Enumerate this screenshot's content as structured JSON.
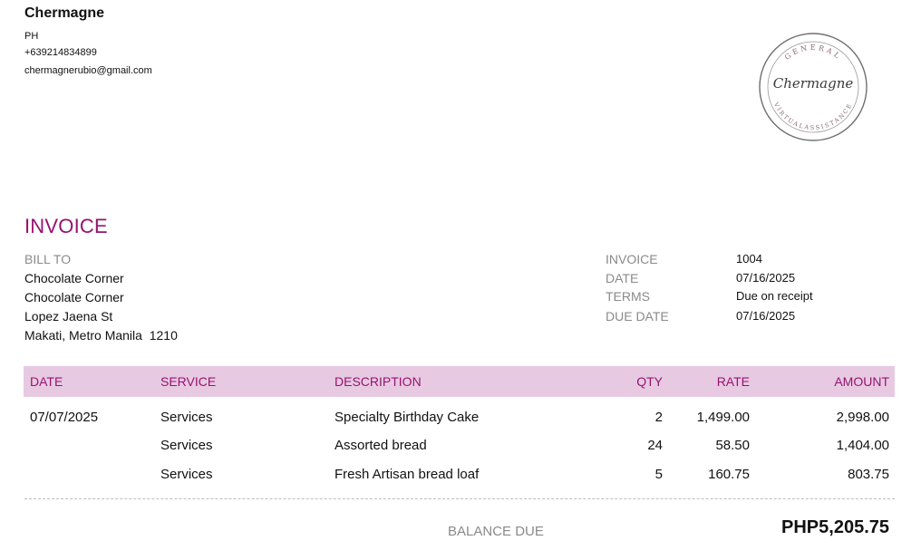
{
  "company": {
    "name": "Chermagne",
    "country": "PH",
    "phone": "+639214834899",
    "email": "chermagnerubio@gmail.com"
  },
  "logo": {
    "script_text": "Chermagne",
    "top_text": "GENERAL",
    "bottom_text": "VIRTUALASSISTANCE"
  },
  "invoice_title": "INVOICE",
  "bill_to": {
    "label": "BILL TO",
    "lines": [
      "Chocolate Corner",
      "Chocolate Corner",
      "Lopez Jaena St",
      "Makati, Metro Manila  1210"
    ]
  },
  "meta": [
    {
      "label": "INVOICE",
      "value": "1004"
    },
    {
      "label": "DATE",
      "value": "07/16/2025"
    },
    {
      "label": "TERMS",
      "value": "Due on receipt"
    },
    {
      "label": "DUE DATE",
      "value": "07/16/2025"
    }
  ],
  "table": {
    "headers": {
      "date": "DATE",
      "service": "SERVICE",
      "description": "DESCRIPTION",
      "qty": "QTY",
      "rate": "RATE",
      "amount": "AMOUNT"
    },
    "rows": [
      {
        "date": "07/07/2025",
        "service": "Services",
        "description": "Specialty Birthday Cake",
        "qty": "2",
        "rate": "1,499.00",
        "amount": "2,998.00"
      },
      {
        "date": "",
        "service": "Services",
        "description": "Assorted bread",
        "qty": "24",
        "rate": "58.50",
        "amount": "1,404.00"
      },
      {
        "date": "",
        "service": "Services",
        "description": "Fresh Artisan bread loaf",
        "qty": "5",
        "rate": "160.75",
        "amount": "803.75"
      }
    ]
  },
  "balance": {
    "label": "BALANCE DUE",
    "value": "PHP5,205.75"
  },
  "colors": {
    "accent": "#97136f",
    "header_bg": "#e8c9e2",
    "muted": "#8a8a8a"
  }
}
